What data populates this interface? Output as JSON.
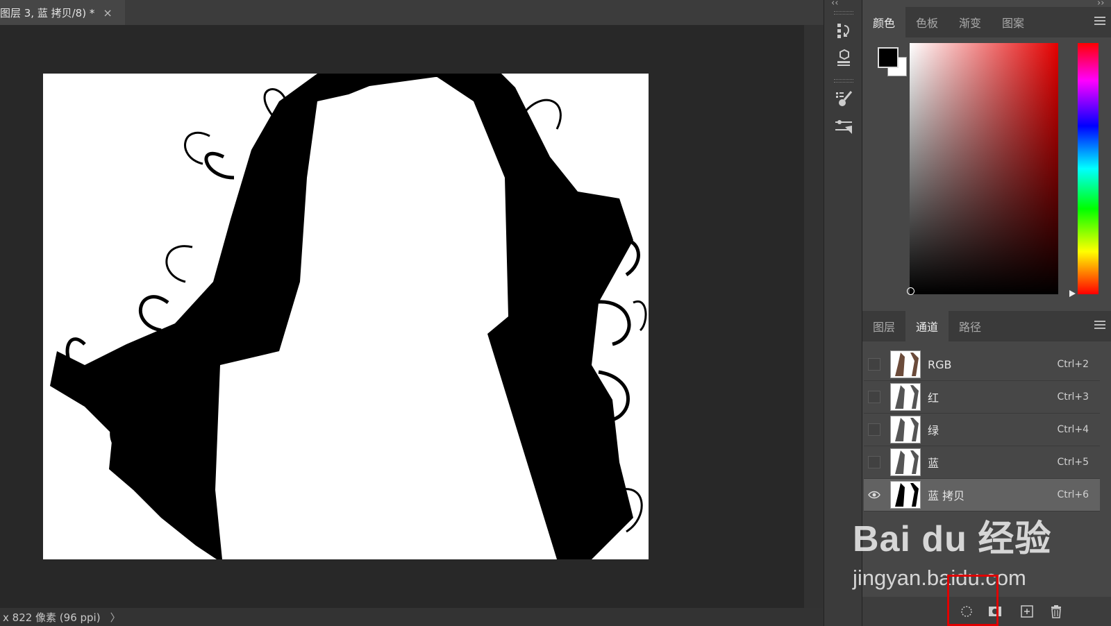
{
  "document": {
    "tab_title": "图层 3, 蓝 拷贝/8) *",
    "close_glyph": "×",
    "status_text": "x 822 像素 (96 ppi)",
    "status_arrow": "〉"
  },
  "toolstrip": {
    "collapse_left": "‹‹",
    "collapse_right": "››",
    "icons": [
      "history-icon",
      "3d-icon",
      "brush-settings-icon",
      "adjustments-icon"
    ]
  },
  "color_panel": {
    "tabs": [
      "颜色",
      "色板",
      "渐变",
      "图案"
    ],
    "active_tab": "颜色",
    "foreground": "#000000",
    "background": "#ffffff",
    "field_hue": "#e50000"
  },
  "channels_panel": {
    "tabs": [
      "图层",
      "通道",
      "路径"
    ],
    "active_tab": "通道",
    "channels": [
      {
        "name": "RGB",
        "shortcut": "Ctrl+2"
      },
      {
        "name": "红",
        "shortcut": "Ctrl+3"
      },
      {
        "name": "绿",
        "shortcut": "Ctrl+4"
      },
      {
        "name": "蓝",
        "shortcut": "Ctrl+5"
      },
      {
        "name": "蓝 拷贝",
        "shortcut": "Ctrl+6"
      }
    ],
    "selected_channel": "蓝 拷贝",
    "bottom_buttons": [
      "load-selection-icon",
      "save-selection-icon",
      "new-channel-icon",
      "delete-channel-icon"
    ]
  },
  "watermark": {
    "logo": "Bai du 经验",
    "url": "jingyan.baidu.com"
  }
}
